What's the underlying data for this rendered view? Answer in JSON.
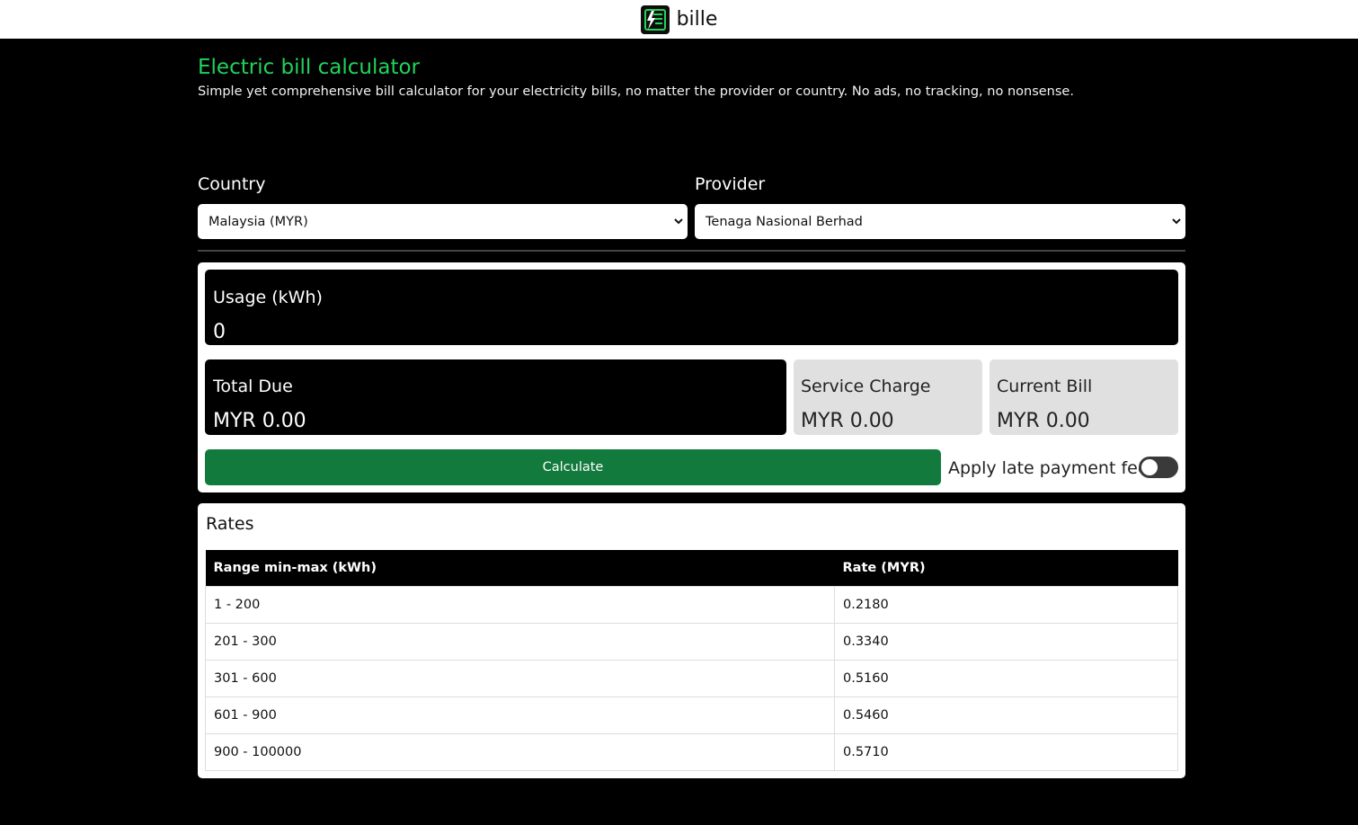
{
  "header": {
    "brand": "bille",
    "logo_icon": "bill-lightning-icon"
  },
  "intro": {
    "title": "Electric bill calculator",
    "subtitle": "Simple yet comprehensive bill calculator for your electricity bills, no matter the provider or country. No ads, no tracking, no nonsense."
  },
  "selectors": {
    "country_label": "Country",
    "country_value": "Malaysia (MYR)",
    "provider_label": "Provider",
    "provider_value": "Tenaga Nasional Berhad"
  },
  "calculator": {
    "usage_label": "Usage (kWh)",
    "usage_value": "0",
    "total_label": "Total Due",
    "total_value": "MYR 0.00",
    "service_label": "Service Charge",
    "service_value": "MYR 0.00",
    "current_label": "Current Bill",
    "current_value": "MYR 0.00",
    "calculate_label": "Calculate",
    "late_fee_label": "Apply late payment fee",
    "late_fee_enabled": false
  },
  "rates": {
    "title": "Rates",
    "columns": [
      "Range min-max (kWh)",
      "Rate (MYR)"
    ],
    "rows": [
      [
        "1 - 200",
        "0.2180"
      ],
      [
        "201 - 300",
        "0.3340"
      ],
      [
        "301 - 600",
        "0.5160"
      ],
      [
        "601 - 900",
        "0.5460"
      ],
      [
        "900 - 100000",
        "0.5710"
      ]
    ]
  },
  "colors": {
    "accent_green": "#22d35a",
    "button_green": "#127a3c"
  }
}
